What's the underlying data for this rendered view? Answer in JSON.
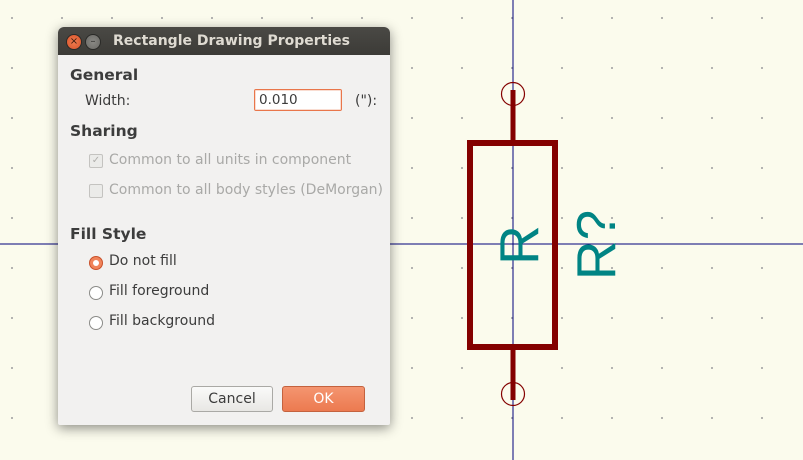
{
  "dialog": {
    "title": "Rectangle Drawing Properties",
    "close_icon": "×",
    "minimize_icon": "–",
    "general": {
      "heading": "General",
      "width_label": "Width:",
      "width_value": "0.010",
      "unit_label": "(\"):"
    },
    "sharing": {
      "heading": "Sharing",
      "common_units_label": "Common to all units in component",
      "common_units_checked": true,
      "common_body_label": "Common to all body styles (DeMorgan)",
      "common_body_checked": false,
      "check_glyph": "✓"
    },
    "fill_style": {
      "heading": "Fill Style",
      "options": [
        {
          "label": "Do not fill",
          "selected": true
        },
        {
          "label": "Fill foreground",
          "selected": false
        },
        {
          "label": "Fill background",
          "selected": false
        }
      ]
    },
    "buttons": {
      "cancel_label": "Cancel",
      "ok_label": "OK"
    }
  },
  "schematic": {
    "component_name": "R",
    "reference": "R?",
    "colors": {
      "body": "#840000",
      "text": "#008484",
      "crosshair": "#00007a",
      "background": "#fbfbed"
    }
  }
}
